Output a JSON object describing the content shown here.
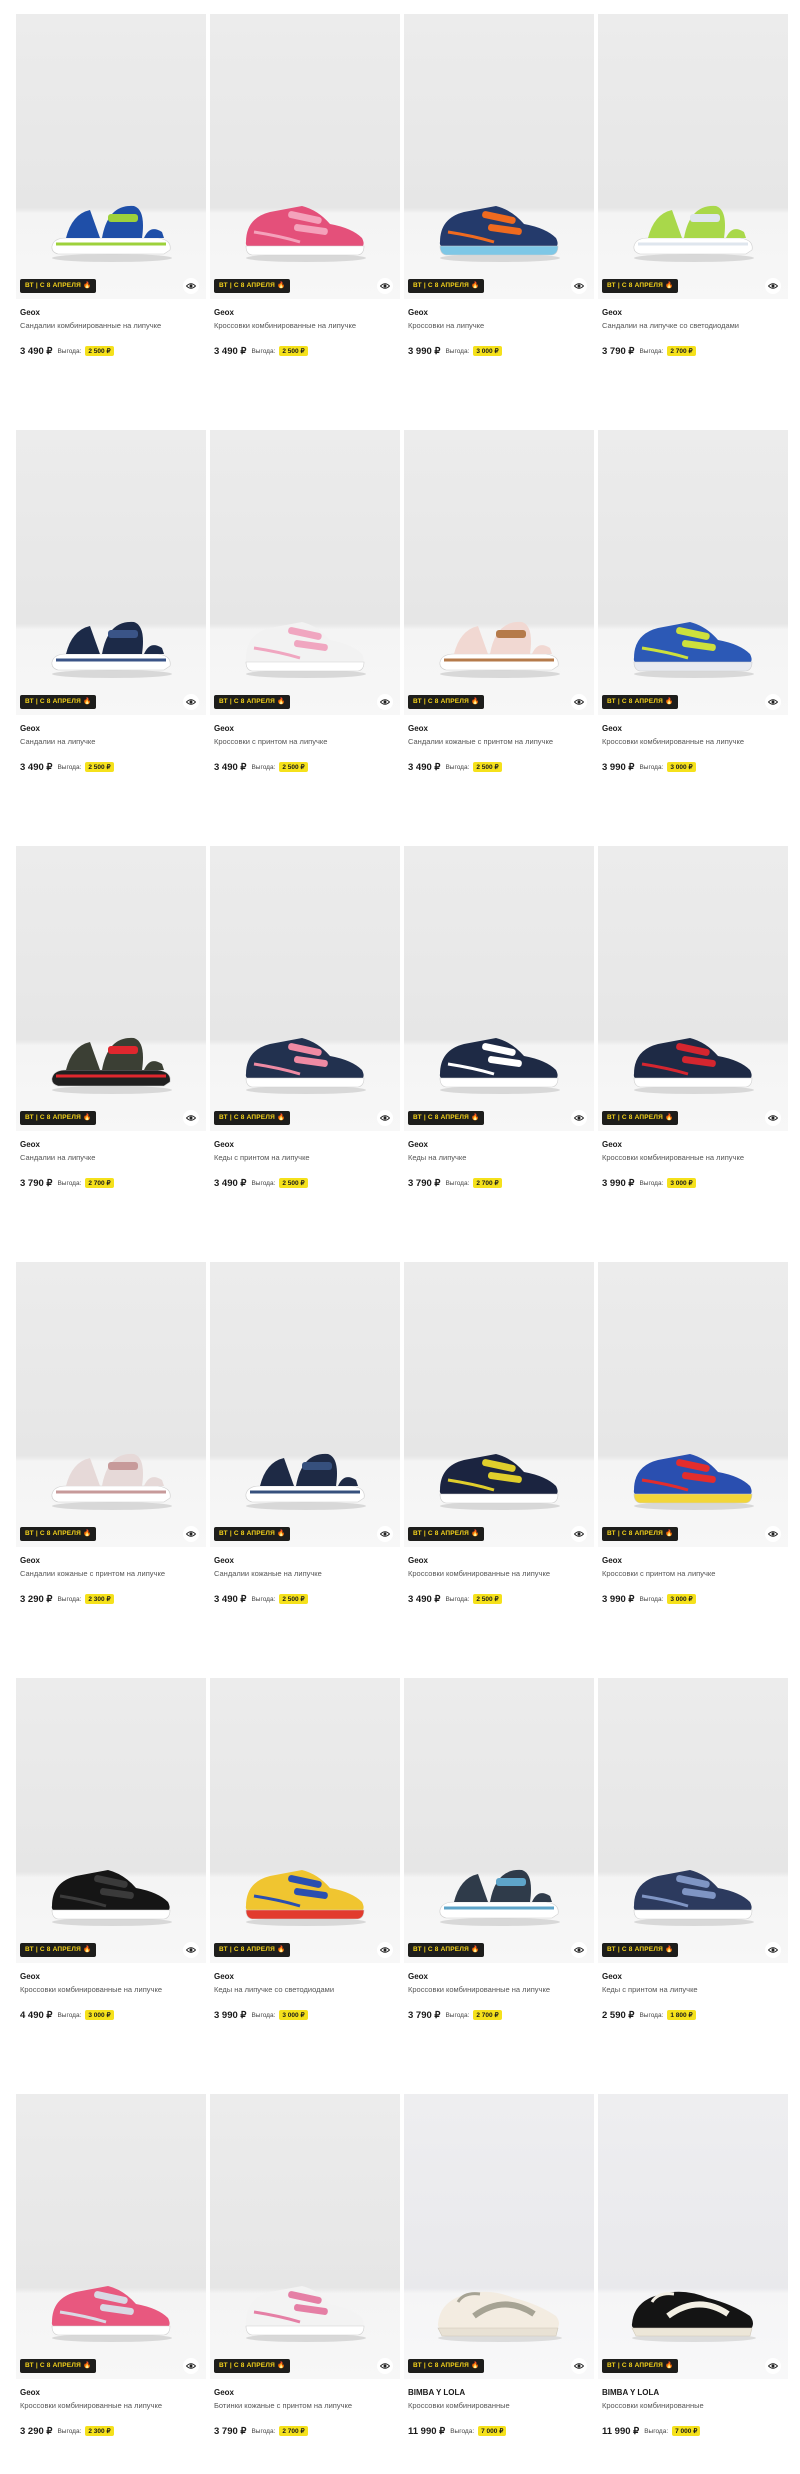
{
  "badge_label": "ВТ | С 8 АПРЕЛЯ 🔥",
  "savings_label": "Выгода:",
  "products": [
    {
      "brand": "Geox",
      "name": "Сандалии комбинированные на липучке",
      "price": "3 490 ₽",
      "savings": "2 500 ₽",
      "colors": [
        "#1f4fa8",
        "#9dd13b",
        "#ffffff"
      ],
      "shape": "sandal"
    },
    {
      "brand": "Geox",
      "name": "Кроссовки комбинированные на липучке",
      "price": "3 490 ₽",
      "savings": "2 500 ₽",
      "colors": [
        "#e4507a",
        "#f4a2bb",
        "#ffffff"
      ],
      "shape": "sneaker"
    },
    {
      "brand": "Geox",
      "name": "Кроссовки на липучке",
      "price": "3 990 ₽",
      "savings": "3 000 ₽",
      "colors": [
        "#243a6b",
        "#ef6a1f",
        "#7ec7e6"
      ],
      "shape": "sneaker"
    },
    {
      "brand": "Geox",
      "name": "Сандалии на липучке со светодиодами",
      "price": "3 790 ₽",
      "savings": "2 700 ₽",
      "colors": [
        "#a9d84a",
        "#dfe6ee",
        "#ffffff"
      ],
      "shape": "sandal"
    },
    {
      "brand": "Geox",
      "name": "Сандалии на липучке",
      "price": "3 490 ₽",
      "savings": "2 500 ₽",
      "colors": [
        "#1c2a48",
        "#3a5487",
        "#ffffff"
      ],
      "shape": "sandal"
    },
    {
      "brand": "Geox",
      "name": "Кроссовки с принтом на липучке",
      "price": "3 490 ₽",
      "savings": "2 500 ₽",
      "colors": [
        "#f2f2f2",
        "#f0a6c0",
        "#ffffff"
      ],
      "shape": "sneaker"
    },
    {
      "brand": "Geox",
      "name": "Сандалии кожаные с принтом на липучке",
      "price": "3 490 ₽",
      "savings": "2 500 ₽",
      "colors": [
        "#f1d8d2",
        "#b57a4a",
        "#ffffff"
      ],
      "shape": "sandal"
    },
    {
      "brand": "Geox",
      "name": "Кроссовки комбинированные на липучке",
      "price": "3 990 ₽",
      "savings": "3 000 ₽",
      "colors": [
        "#2c59b6",
        "#cde03c",
        "#e8eaf0"
      ],
      "shape": "sneaker"
    },
    {
      "brand": "Geox",
      "name": "Сандалии на липучке",
      "price": "3 790 ₽",
      "savings": "2 700 ₽",
      "colors": [
        "#3b3f34",
        "#e0272e",
        "#202020"
      ],
      "shape": "sandal"
    },
    {
      "brand": "Geox",
      "name": "Кеды с принтом на липучке",
      "price": "3 490 ₽",
      "savings": "2 500 ₽",
      "colors": [
        "#22314f",
        "#ef8aa3",
        "#ffffff"
      ],
      "shape": "sneaker"
    },
    {
      "brand": "Geox",
      "name": "Кеды на липучке",
      "price": "3 790 ₽",
      "savings": "2 700 ₽",
      "colors": [
        "#1e2a45",
        "#ffffff",
        "#ffffff"
      ],
      "shape": "sneaker"
    },
    {
      "brand": "Geox",
      "name": "Кроссовки комбинированные на липучке",
      "price": "3 990 ₽",
      "savings": "3 000 ₽",
      "colors": [
        "#1e2a45",
        "#d5262f",
        "#ffffff"
      ],
      "shape": "sneaker"
    },
    {
      "brand": "Geox",
      "name": "Сандалии кожаные с принтом на липучке",
      "price": "3 290 ₽",
      "savings": "2 300 ₽",
      "colors": [
        "#e6d9d8",
        "#c79a9a",
        "#ffffff"
      ],
      "shape": "sandal"
    },
    {
      "brand": "Geox",
      "name": "Сандалии кожаные на липучке",
      "price": "3 490 ₽",
      "savings": "2 500 ₽",
      "colors": [
        "#1e2a45",
        "#36507d",
        "#ffffff"
      ],
      "shape": "sandal"
    },
    {
      "brand": "Geox",
      "name": "Кроссовки комбинированные на липучке",
      "price": "3 490 ₽",
      "savings": "2 500 ₽",
      "colors": [
        "#1b2440",
        "#e0ce2c",
        "#ffffff"
      ],
      "shape": "sneaker"
    },
    {
      "brand": "Geox",
      "name": "Кроссовки с принтом на липучке",
      "price": "3 990 ₽",
      "savings": "3 000 ₽",
      "colors": [
        "#2a4fb0",
        "#e32d2d",
        "#f2d63a"
      ],
      "shape": "sneaker"
    },
    {
      "brand": "Geox",
      "name": "Кроссовки комбинированные на липучке",
      "price": "4 490 ₽",
      "savings": "3 000 ₽",
      "colors": [
        "#151515",
        "#3a3a3a",
        "#ffffff"
      ],
      "shape": "sneaker"
    },
    {
      "brand": "Geox",
      "name": "Кеды на липучке со светодиодами",
      "price": "3 990 ₽",
      "savings": "3 000 ₽",
      "colors": [
        "#f0c530",
        "#2a4fb0",
        "#e23b2e"
      ],
      "shape": "sneaker"
    },
    {
      "brand": "Geox",
      "name": "Кроссовки комбинированные на липучке",
      "price": "3 790 ₽",
      "savings": "2 700 ₽",
      "colors": [
        "#2f3b4a",
        "#5ea4c9",
        "#ffffff"
      ],
      "shape": "sandal"
    },
    {
      "brand": "Geox",
      "name": "Кеды с принтом на липучке",
      "price": "2 590 ₽",
      "savings": "1 800 ₽",
      "colors": [
        "#2c3a5e",
        "#7f95c4",
        "#ffffff"
      ],
      "shape": "sneaker"
    },
    {
      "brand": "Geox",
      "name": "Кроссовки комбинированные на липучке",
      "price": "3 290 ₽",
      "savings": "2 300 ₽",
      "colors": [
        "#e8587f",
        "#d9d9e4",
        "#ffffff"
      ],
      "shape": "sneaker"
    },
    {
      "brand": "Geox",
      "name": "Ботинки кожаные с принтом на липучке",
      "price": "3 790 ₽",
      "savings": "2 700 ₽",
      "colors": [
        "#f3f3f3",
        "#e57fa5",
        "#ffffff"
      ],
      "shape": "sneaker"
    },
    {
      "brand": "BIMBA Y LOLA",
      "name": "Кроссовки комбинированные",
      "price": "11 990 ₽",
      "savings": "7 000 ₽",
      "colors": [
        "#f3ece1",
        "#a6a394",
        "#e8e1d4"
      ],
      "shape": "runner",
      "light": true
    },
    {
      "brand": "BIMBA Y LOLA",
      "name": "Кроссовки комбинированные",
      "price": "11 990 ₽",
      "savings": "7 000 ₽",
      "colors": [
        "#141414",
        "#f3efe4",
        "#ece6d8"
      ],
      "shape": "runner",
      "light": true
    }
  ]
}
